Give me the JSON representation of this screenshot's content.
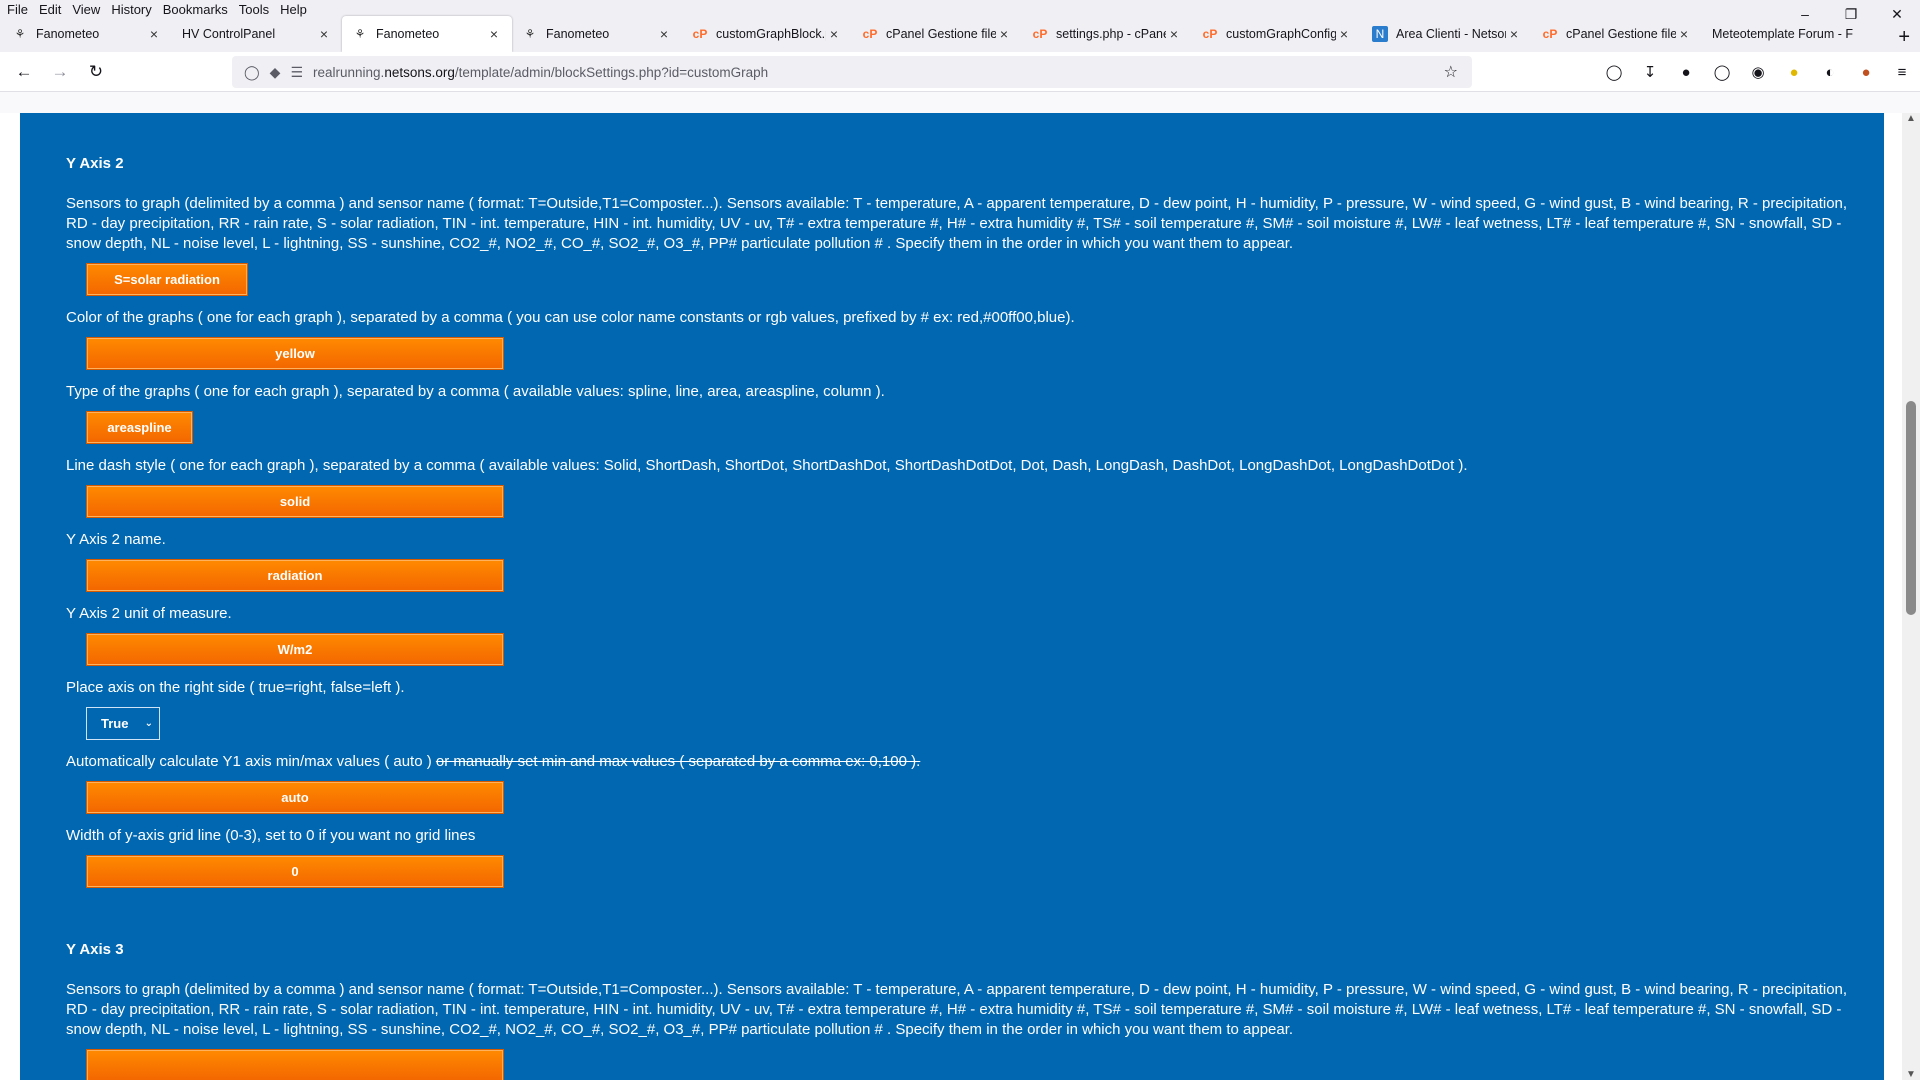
{
  "menu": [
    "File",
    "Edit",
    "View",
    "History",
    "Bookmarks",
    "Tools",
    "Help"
  ],
  "menu_accel": [
    "F",
    "E",
    "V",
    "H",
    "B",
    "T",
    "H"
  ],
  "tabs": [
    {
      "title": "Fanometeo",
      "icon": "fanometeo-icon"
    },
    {
      "title": "HV ControlPanel",
      "icon": "none"
    },
    {
      "title": "Fanometeo",
      "icon": "fanometeo-icon",
      "active": true
    },
    {
      "title": "Fanometeo",
      "icon": "fanometeo-icon"
    },
    {
      "title": "customGraphBlock.p",
      "icon": "cpanel-icon"
    },
    {
      "title": "cPanel Gestione file v",
      "icon": "cpanel-icon"
    },
    {
      "title": "settings.php - cPanel",
      "icon": "cpanel-icon"
    },
    {
      "title": "customGraphConfig.",
      "icon": "cpanel-icon"
    },
    {
      "title": "Area Clienti - Netsons",
      "icon": "netsons-icon"
    },
    {
      "title": "cPanel Gestione file v",
      "icon": "cpanel-icon"
    },
    {
      "title": "Meteotemplate Forum - F",
      "icon": "none"
    }
  ],
  "url": {
    "prefix": "realrunning.",
    "host": "netsons.org",
    "path": "/template/admin/blockSettings.php?id=customGraph"
  },
  "sensors_desc": "Sensors to graph (delimited by a comma ) and sensor name ( format: T=Outside,T1=Composter...). Sensors available: T - temperature, A - apparent temperature, D - dew point, H - humidity, P - pressure, W - wind speed, G - wind gust, B - wind bearing, R - precipitation, RD - day precipitation, RR - rain rate, S - solar radiation, TIN - int. temperature, HIN - int. humidity, UV - uv, T# - extra temperature #, H# - extra humidity #, TS# - soil temperature #, SM# - soil moisture #, LW# - leaf wetness, LT# - leaf temperature #, SN - snowfall, SD - snow depth, NL - noise level, L - lightning, SS - sunshine, CO2_#, NO2_#, CO_#, SO2_#, O3_#, PP# particulate pollution # . Specify them in the order in which you want them to appear.",
  "yaxis2": {
    "title": "Y Axis 2",
    "sensors_value": "S=solar radiation",
    "color_label": "Color of the graphs ( one for each graph ), separated by a comma ( you can use color name constants or rgb values, prefixed by # ex: red,#00ff00,blue).",
    "color_value": "yellow",
    "type_label": "Type of the graphs ( one for each graph ), separated by a comma ( available values: spline, line, area, areaspline, column ).",
    "type_value": "areaspline",
    "dash_label": "Line dash style ( one for each graph ), separated by a comma ( available values: Solid, ShortDash, ShortDot, ShortDashDot, ShortDashDotDot, Dot, Dash, LongDash, DashDot, LongDashDot, LongDashDotDot ).",
    "dash_value": "solid",
    "name_label": "Y Axis 2 name.",
    "name_value": "radiation",
    "unit_label": "Y Axis 2 unit of measure.",
    "unit_value": "W/m2",
    "side_label": "Place axis on the right side ( true=right, false=left ).",
    "side_value": "True",
    "minmax_label": "Automatically calculate Y1 axis min/max values ( auto ) ",
    "minmax_label_strike": "or manually set min and max values ( separated by a comma ex: 0,100 ).",
    "minmax_value": "auto",
    "grid_label": "Width of y-axis grid line (0-3), set to 0 if you want no grid lines",
    "grid_value": "0"
  },
  "yaxis3": {
    "title": "Y Axis 3",
    "sensors_value": ""
  }
}
